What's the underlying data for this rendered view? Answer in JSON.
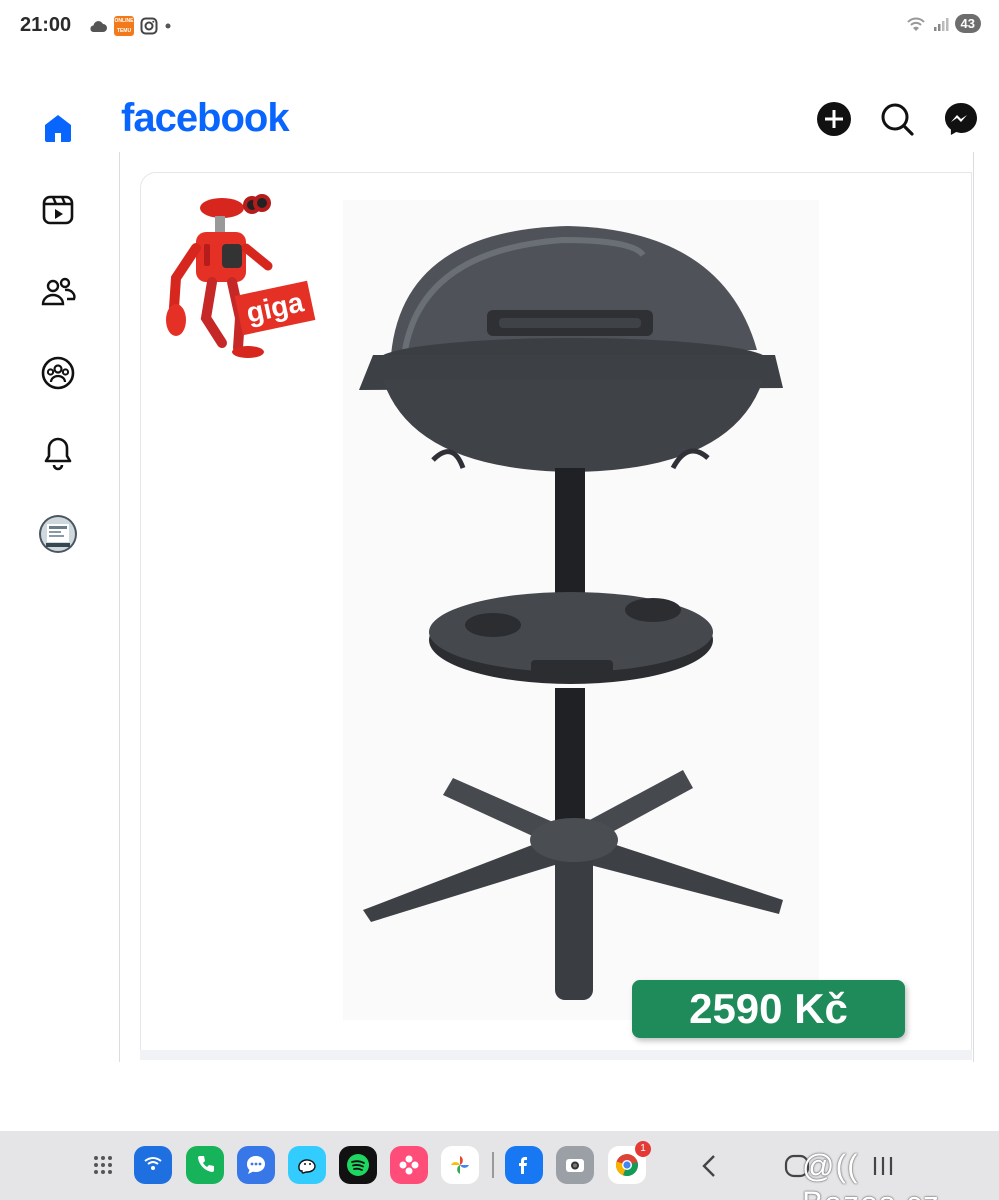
{
  "status_bar": {
    "time": "21:00",
    "battery": "43",
    "temu_lines": [
      "ONLINE",
      "TEMU"
    ]
  },
  "app": {
    "brand": "facebook"
  },
  "left_rail": [
    {
      "name": "home-icon"
    },
    {
      "name": "video-icon"
    },
    {
      "name": "friends-icon"
    },
    {
      "name": "groups-icon"
    },
    {
      "name": "notifications-icon"
    },
    {
      "name": "profile-avatar"
    }
  ],
  "header_actions": [
    {
      "name": "create-icon"
    },
    {
      "name": "search-icon"
    },
    {
      "name": "messenger-icon"
    }
  ],
  "post": {
    "logo_text": "giga",
    "price": "2590 Kč",
    "price_color": "#1f8a5a"
  },
  "dock": {
    "notification_count": "1",
    "watermark": "@(( Bazos.cz",
    "apps": [
      "app-drawer-icon",
      "wallet-app-icon",
      "phone-app-icon",
      "messages-app-icon",
      "waze-app-icon",
      "spotify-app-icon",
      "gallery-app-icon",
      "photos-app-icon",
      "facebook-app-icon",
      "camera-app-icon",
      "chrome-app-icon"
    ]
  },
  "colors": {
    "facebook_blue": "#0866ff",
    "dock_bg": "#e5e5e7"
  }
}
